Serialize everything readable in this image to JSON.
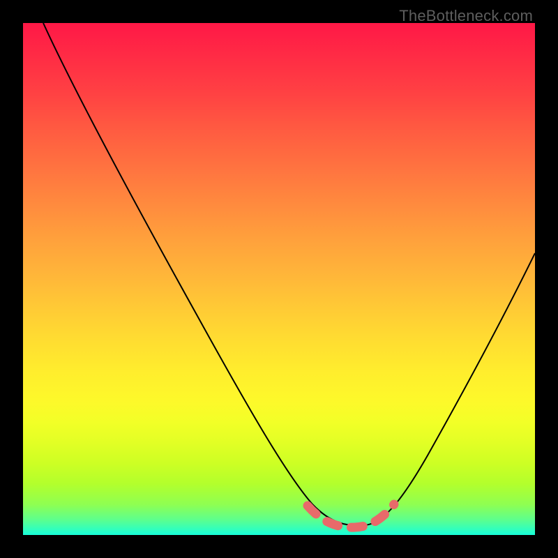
{
  "watermark": "TheBottleneck.com",
  "chart_data": {
    "type": "line",
    "title": "",
    "xlabel": "",
    "ylabel": "",
    "xlim": [
      0,
      100
    ],
    "ylim": [
      0,
      100
    ],
    "grid": false,
    "legend": false,
    "colors": {
      "gradient_top": "#ff1846",
      "gradient_bottom": "#17ffda",
      "curve": "#000000",
      "highlight": "#e86a6a",
      "frame": "#000000"
    },
    "series": [
      {
        "name": "bottleneck-curve",
        "x": [
          4,
          8,
          14,
          22,
          30,
          38,
          46,
          52,
          56,
          58,
          60,
          62,
          64,
          66,
          68,
          70,
          74,
          80,
          86,
          92,
          96
        ],
        "y": [
          100,
          92,
          82,
          68,
          55,
          42,
          29,
          18,
          11,
          8,
          5,
          3,
          2,
          2,
          3,
          5,
          10,
          20,
          33,
          48,
          59
        ]
      }
    ],
    "highlight_range": {
      "description": "dashed salmon segment near curve minimum",
      "x_start": 56,
      "x_end": 72
    },
    "curve_minimum": {
      "x": 65,
      "y": 2
    }
  }
}
